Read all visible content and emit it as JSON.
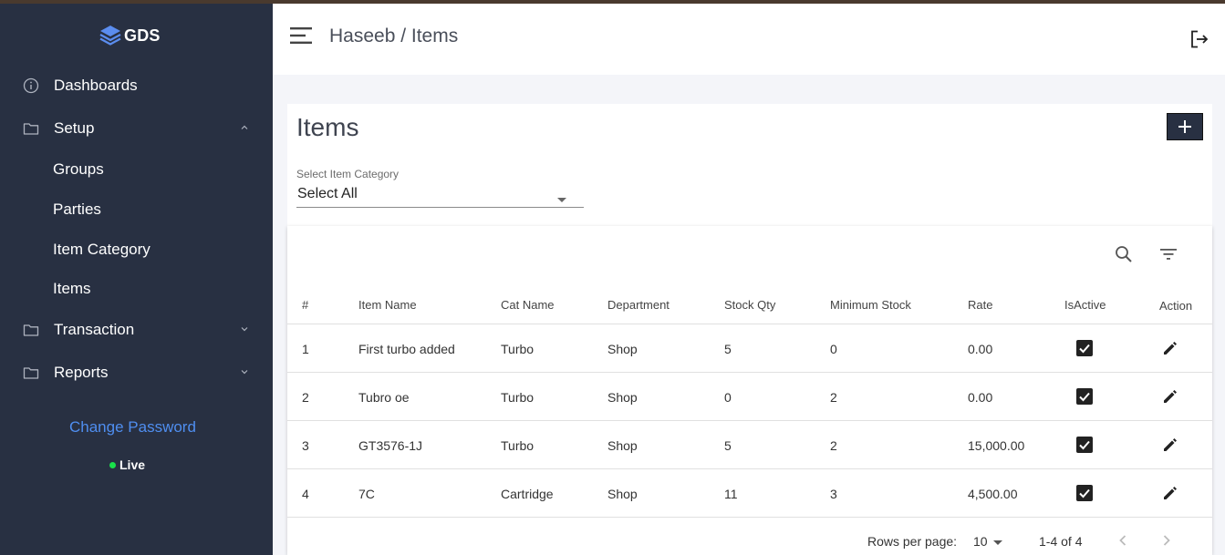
{
  "brand": {
    "name": "GDS"
  },
  "sidebar": {
    "items": [
      {
        "label": "Dashboards",
        "icon": "info-circle-icon"
      },
      {
        "label": "Setup",
        "icon": "folder-icon",
        "expanded": true,
        "children": [
          "Groups",
          "Parties",
          "Item Category",
          "Items"
        ]
      },
      {
        "label": "Transaction",
        "icon": "folder-icon",
        "expanded": false
      },
      {
        "label": "Reports",
        "icon": "folder-icon",
        "expanded": false
      }
    ],
    "change_password": "Change Password",
    "status": "Live"
  },
  "header": {
    "breadcrumb": "Haseeb / Items",
    "menu_icon": "hamburger-menu-icon",
    "logout_icon": "logout-icon"
  },
  "page": {
    "title": "Items",
    "add_icon": "plus-icon",
    "category_select": {
      "label": "Select Item Category",
      "value": "Select All"
    }
  },
  "table": {
    "toolbar_icons": [
      "search-icon",
      "filter-list-icon"
    ],
    "columns": [
      "#",
      "Item Name",
      "Cat Name",
      "Department",
      "Stock Qty",
      "Minimum Stock",
      "Rate",
      "IsActive",
      "Action"
    ],
    "rows": [
      {
        "num": "1",
        "item_name": "First turbo added",
        "cat_name": "Turbo",
        "department": "Shop",
        "stock_qty": "5",
        "min_stock": "0",
        "rate": "0.00",
        "is_active": true
      },
      {
        "num": "2",
        "item_name": "Tubro oe",
        "cat_name": "Turbo",
        "department": "Shop",
        "stock_qty": "0",
        "min_stock": "2",
        "rate": "0.00",
        "is_active": true
      },
      {
        "num": "3",
        "item_name": "GT3576-1J",
        "cat_name": "Turbo",
        "department": "Shop",
        "stock_qty": "5",
        "min_stock": "2",
        "rate": "15,000.00",
        "is_active": true
      },
      {
        "num": "4",
        "item_name": "7C",
        "cat_name": "Cartridge",
        "department": "Shop",
        "stock_qty": "11",
        "min_stock": "3",
        "rate": "4,500.00",
        "is_active": true
      }
    ],
    "pagination": {
      "rows_per_page_label": "Rows per page:",
      "rows_per_page": "10",
      "range": "1-4 of 4"
    }
  },
  "colors": {
    "sidebar_bg": "#283042",
    "link": "#4f8ef0",
    "live": "#19e04a",
    "add_button": "#283042"
  }
}
